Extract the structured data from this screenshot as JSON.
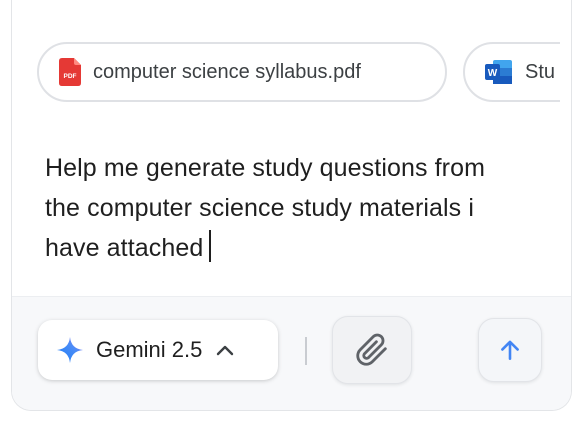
{
  "attachments": [
    {
      "name": "computer science syllabus.pdf",
      "icon": "pdf-file-icon",
      "icon_color": "#e53935"
    },
    {
      "name": "Stu",
      "icon": "word-file-icon",
      "icon_color": "#185abd"
    }
  ],
  "prompt": {
    "text": "Help me generate study questions from the computer science study materials i have attached"
  },
  "toolbar": {
    "model_label": "Gemini 2.5",
    "model_icon": "gemini-sparkle-icon",
    "attach_icon": "paperclip-icon",
    "send_icon": "arrow-up-icon",
    "accent_color": "#4285f4"
  }
}
